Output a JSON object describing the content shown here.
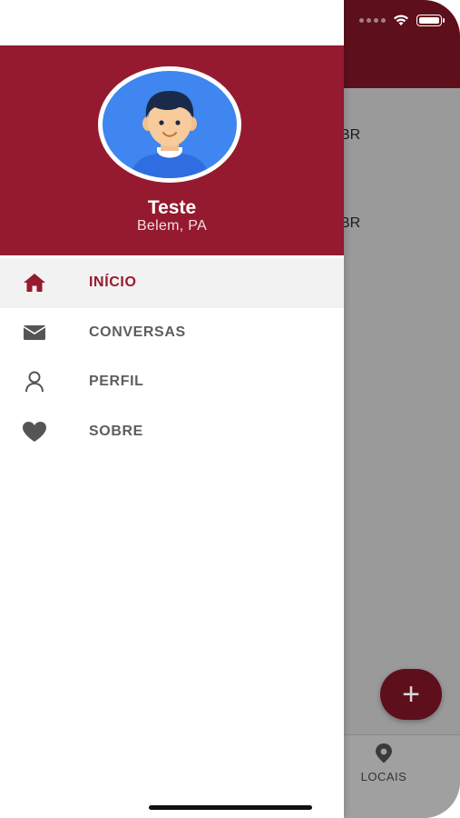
{
  "background_screen": {
    "list_items": [
      "BR",
      "BR"
    ],
    "fab_label": "+",
    "tab_bar": {
      "locais_label": "LOCAIS",
      "locais_icon": "location-pin-icon"
    }
  },
  "drawer": {
    "profile": {
      "name": "Teste",
      "location": "Belem, PA",
      "avatar_icon": "user-avatar-icon"
    },
    "menu": [
      {
        "label": "INÍCIO",
        "icon": "home-icon",
        "active": true
      },
      {
        "label": "CONVERSAS",
        "icon": "mail-icon",
        "active": false
      },
      {
        "label": "PERFIL",
        "icon": "person-icon",
        "active": false
      },
      {
        "label": "SOBRE",
        "icon": "heart-icon",
        "active": false
      }
    ]
  },
  "colors": {
    "primary": "#951a2f",
    "primary_dark": "#5e0f1c",
    "menu_text": "#5e5e5e",
    "active_bg": "#f2f2f2"
  }
}
